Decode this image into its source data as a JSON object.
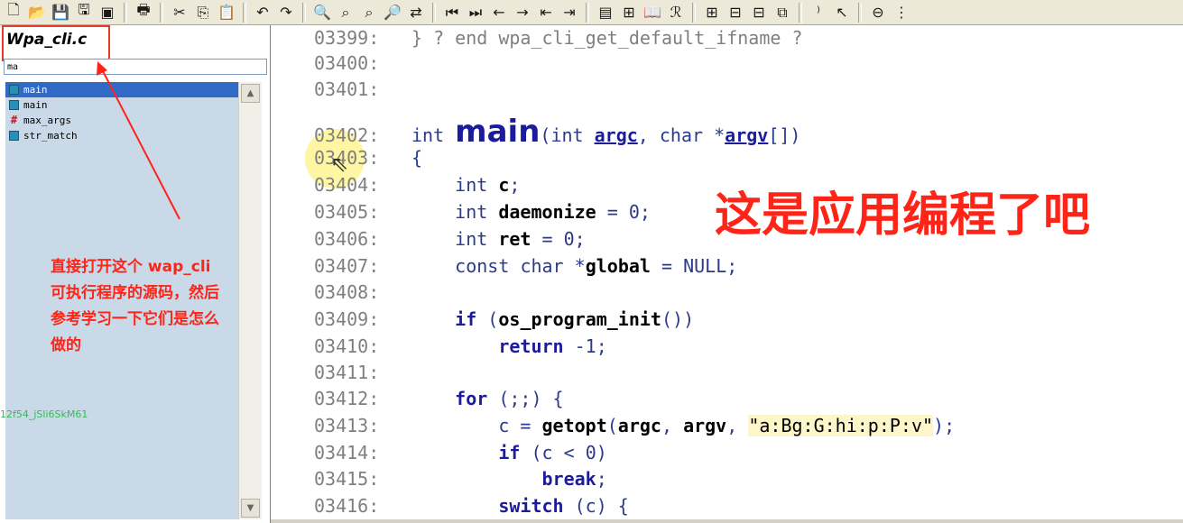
{
  "left_panel": {
    "file_title": "Wpa_cli.c",
    "search_value": "ma",
    "symbols": [
      {
        "name": "main",
        "icon": "function-icon",
        "selected": true
      },
      {
        "name": "main",
        "icon": "function-icon",
        "selected": false
      },
      {
        "name": "max_args",
        "icon": "macro-icon",
        "selected": false
      },
      {
        "name": "str_match",
        "icon": "function-icon",
        "selected": false
      }
    ],
    "note_lines": [
      "直接打开这个 wap_cli",
      "可执行程序的源码，然后",
      "参考学习一下它们是怎么",
      "做的"
    ],
    "watermark": "12f54_jSli6SkM61"
  },
  "code": {
    "lines": [
      {
        "num": "03399:",
        "text": "} ? end wpa_cli_get_default_ifname ?"
      },
      {
        "num": "03400:",
        "text": ""
      },
      {
        "num": "03401:",
        "text": ""
      },
      {
        "num": "03402:",
        "text": "int main(int argc, char *argv[])"
      },
      {
        "num": "03403:",
        "text": "{"
      },
      {
        "num": "03404:",
        "text": "int c;"
      },
      {
        "num": "03405:",
        "text": "int daemonize = 0;"
      },
      {
        "num": "03406:",
        "text": "int ret = 0;"
      },
      {
        "num": "03407:",
        "text": "const char *global = NULL;"
      },
      {
        "num": "03408:",
        "text": ""
      },
      {
        "num": "03409:",
        "text": "if (os_program_init())"
      },
      {
        "num": "03410:",
        "text": "return -1;"
      },
      {
        "num": "03411:",
        "text": ""
      },
      {
        "num": "03412:",
        "text": "for (;;) {"
      },
      {
        "num": "03413:",
        "text": "c = getopt(argc, argv, \"a:Bg:G:hi:p:P:v\");"
      },
      {
        "num": "03414:",
        "text": "if (c < 0)"
      },
      {
        "num": "03415:",
        "text": "break;"
      },
      {
        "num": "03416:",
        "text": "switch (c) {"
      }
    ],
    "annotation": "这是应用编程了吧"
  },
  "colors": {
    "annotation_red": "#ff2418",
    "selection_blue": "#3169c6",
    "keyword_blue": "#1c1c9a"
  }
}
